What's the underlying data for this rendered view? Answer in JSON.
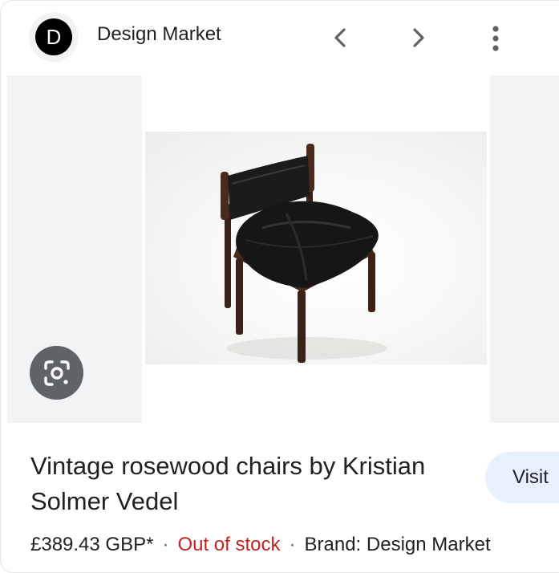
{
  "header": {
    "site_initial": "D",
    "site_name": "Design Market",
    "icons": [
      "chevron-left-icon",
      "chevron-right-icon",
      "more-vert-icon"
    ]
  },
  "gallery": {
    "lens_icon": "google-lens-icon"
  },
  "product": {
    "title": "Vintage rosewood chairs by Kristian Solmer Vedel",
    "visit_label": "Visit",
    "price": "£389.43 GBP*",
    "separator": "·",
    "availability": "Out of stock",
    "brand": "Brand: Design Market"
  },
  "colors": {
    "out_of_stock": "#c5221f",
    "visit_button_bg": "#e8f0fe",
    "side_panel": "#f1f3f4",
    "lens_button": "#5f6368"
  }
}
